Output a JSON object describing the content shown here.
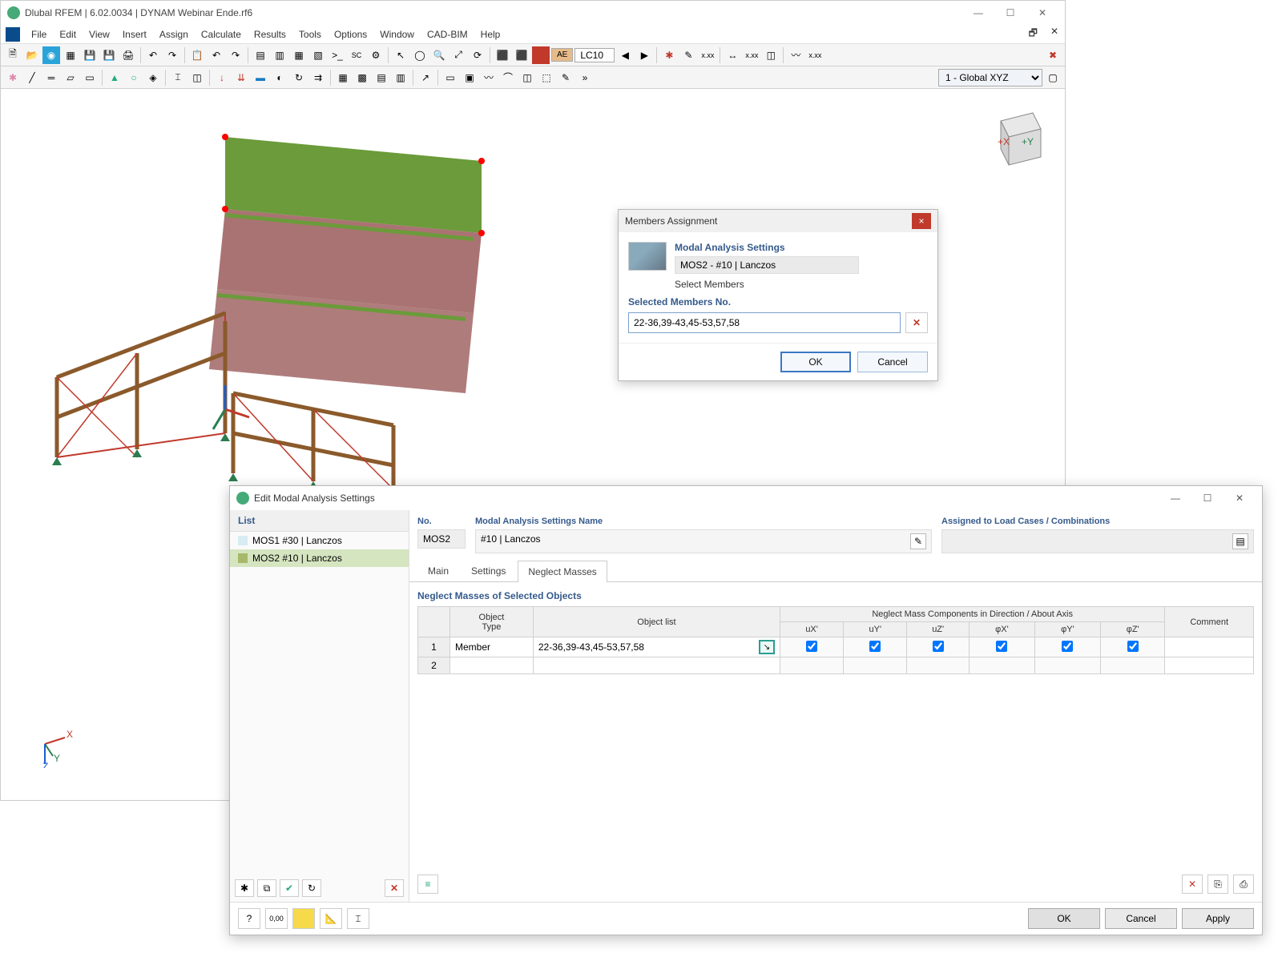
{
  "app": {
    "title": "Dlubal RFEM | 6.02.0034 | DYNAM Webinar Ende.rf6",
    "menu": [
      "File",
      "Edit",
      "View",
      "Insert",
      "Assign",
      "Calculate",
      "Results",
      "Tools",
      "Options",
      "Window",
      "CAD-BIM",
      "Help"
    ],
    "load_case_label": "LC10",
    "coord_system": "1 - Global XYZ"
  },
  "members_dialog": {
    "title": "Members Assignment",
    "settings_label": "Modal Analysis Settings",
    "settings_value": "MOS2 - #10 | Lanczos",
    "select_members_label": "Select Members",
    "selected_label": "Selected Members No.",
    "selected_value": "22-36,39-43,45-53,57,58",
    "ok": "OK",
    "cancel": "Cancel"
  },
  "modal_settings": {
    "title": "Edit Modal Analysis Settings",
    "list_header": "List",
    "list_items": [
      {
        "label": "MOS1  #30 | Lanczos",
        "selected": false
      },
      {
        "label": "MOS2  #10 | Lanczos",
        "selected": true
      }
    ],
    "no_label": "No.",
    "no_value": "MOS2",
    "name_label": "Modal Analysis Settings Name",
    "name_value": "#10 | Lanczos",
    "assigned_label": "Assigned to Load Cases / Combinations",
    "assigned_value": "",
    "tabs": [
      "Main",
      "Settings",
      "Neglect Masses"
    ],
    "active_tab": 2,
    "section_title": "Neglect Masses of Selected Objects",
    "table": {
      "cols_top": [
        "Object Type",
        "Object list",
        "Neglect Mass Components in Direction / About Axis",
        "Comment"
      ],
      "mass_cols": [
        "uX'",
        "uY'",
        "uZ'",
        "φX'",
        "φY'",
        "φZ'"
      ],
      "rows": [
        {
          "n": "1",
          "type": "Member",
          "list": "22-36,39-43,45-53,57,58",
          "checks": [
            true,
            true,
            true,
            true,
            true,
            true
          ],
          "comment": ""
        },
        {
          "n": "2",
          "type": "",
          "list": "",
          "checks": [
            null,
            null,
            null,
            null,
            null,
            null
          ],
          "comment": ""
        }
      ]
    },
    "ok": "OK",
    "cancel": "Cancel",
    "apply": "Apply"
  }
}
